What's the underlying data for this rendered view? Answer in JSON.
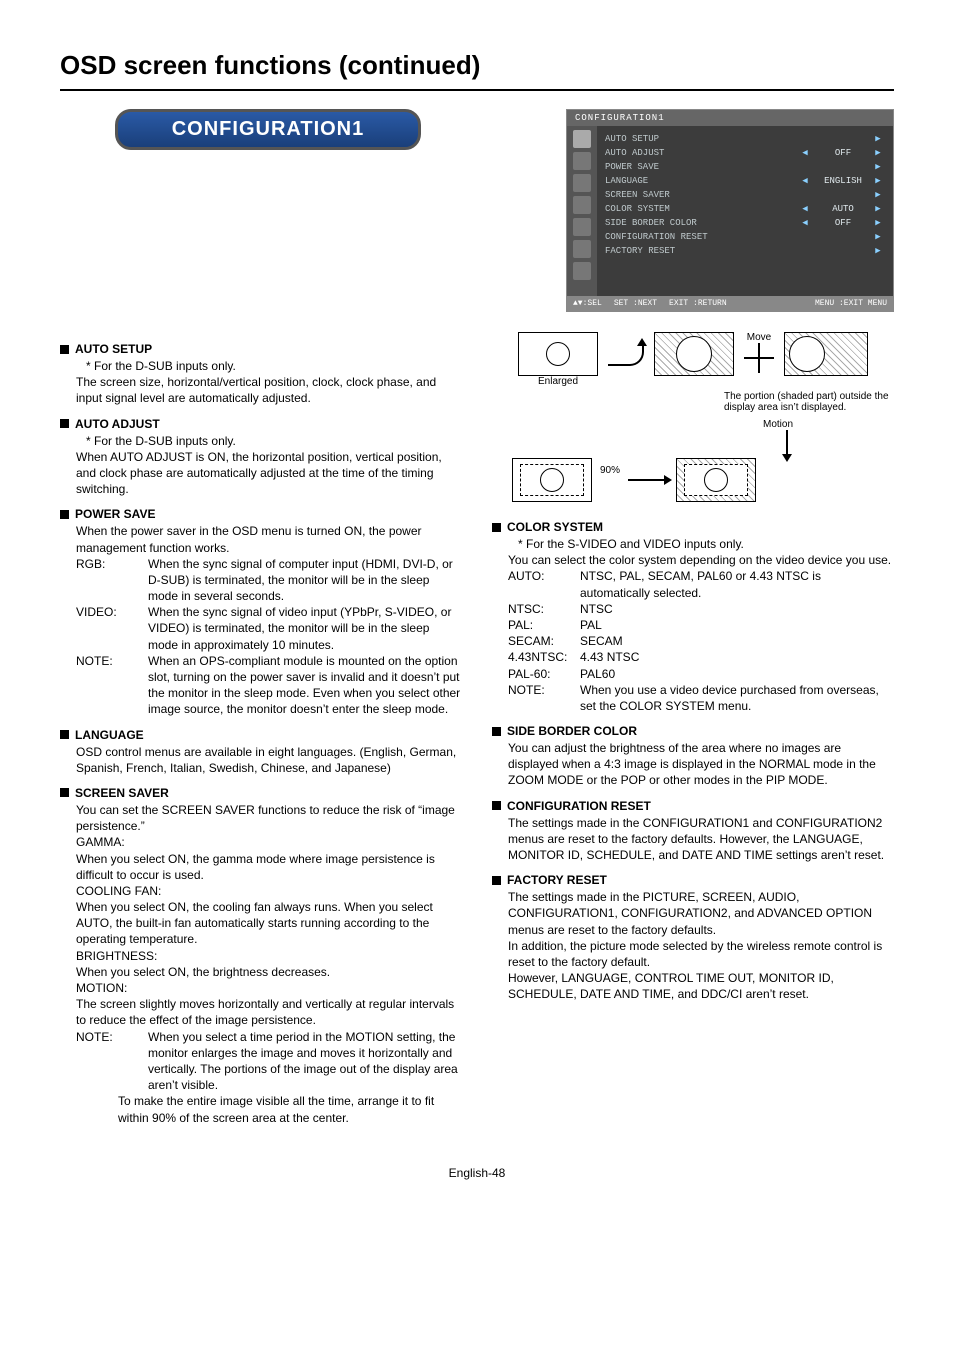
{
  "page_title": "OSD screen functions (continued)",
  "section_banner": "CONFIGURATION1",
  "osd": {
    "title": "CONFIGURATION1",
    "rows": [
      {
        "label": "AUTO SETUP",
        "left": false,
        "value": "",
        "right": true
      },
      {
        "label": "AUTO ADJUST",
        "left": true,
        "value": "OFF",
        "right": true
      },
      {
        "label": "POWER SAVE",
        "left": false,
        "value": "",
        "right": true
      },
      {
        "label": "LANGUAGE",
        "left": true,
        "value": "ENGLISH",
        "right": true
      },
      {
        "label": "SCREEN SAVER",
        "left": false,
        "value": "",
        "right": true
      },
      {
        "label": "COLOR SYSTEM",
        "left": true,
        "value": "AUTO",
        "right": true
      },
      {
        "label": "SIDE BORDER COLOR",
        "left": true,
        "value": "OFF",
        "right": true
      },
      {
        "label": "CONFIGURATION RESET",
        "left": false,
        "value": "",
        "right": true
      },
      {
        "label": "FACTORY RESET",
        "left": false,
        "value": "",
        "right": true
      }
    ],
    "footer": {
      "sel": "▲▼:SEL",
      "next": "SET :NEXT",
      "ret": "EXIT :RETURN",
      "exitmenu": "MENU :EXIT MENU"
    }
  },
  "diagram": {
    "enlarged": "Enlarged",
    "move": "Move",
    "portion_note": "The portion (shaded part) outside the display area isn’t displayed.",
    "motion": "Motion",
    "ninety": "90%"
  },
  "left": {
    "auto_setup": {
      "head": "AUTO SETUP",
      "star": "*",
      "star_text": "For the D-SUB inputs only.",
      "body": "The screen size, horizontal/vertical position, clock, clock phase, and input signal level are automatically adjusted."
    },
    "auto_adjust": {
      "head": "AUTO ADJUST",
      "star": "*",
      "star_text": "For the D-SUB inputs only.",
      "body": "When AUTO ADJUST is ON, the horizontal position, vertical position, and clock phase are automatically adjusted at the time of the timing switching."
    },
    "power_save": {
      "head": "POWER SAVE",
      "intro": "When the power saver in the OSD menu is turned ON, the power management function works.",
      "rgb_k": "RGB:",
      "rgb_v": "When the sync signal of computer input (HDMI, DVI-D, or D-SUB) is terminated, the monitor will be in the sleep mode in several seconds.",
      "video_k": "VIDEO:",
      "video_v": "When the sync signal of video input (YPbPr, S-VIDEO, or VIDEO) is terminated, the monitor will be in the sleep mode in approximately 10 minutes.",
      "note_k": "NOTE:",
      "note_v": "When an OPS-compliant module is mounted on the option slot, turning on the power saver is invalid and it doesn’t put the monitor in the sleep mode. Even when you select other image source, the monitor doesn’t enter the sleep mode."
    },
    "language": {
      "head": "LANGUAGE",
      "body": "OSD control menus are available in eight languages. (English, German, Spanish, French, Italian, Swedish, Chinese, and Japanese)"
    },
    "screen_saver": {
      "head": "SCREEN SAVER",
      "intro": "You can set the SCREEN SAVER functions to reduce the risk of “image persistence.”",
      "gamma_k": "GAMMA:",
      "gamma_v": "When you select ON, the gamma mode where image persistence is difficult to occur is used.",
      "fan_k": "COOLING FAN:",
      "fan_v": "When you select ON, the cooling fan always runs. When you select AUTO, the built-in fan automatically starts running according to the operating temperature.",
      "bright_k": "BRIGHTNESS:",
      "bright_v": "When you select ON, the brightness decreases.",
      "motion_k": "MOTION:",
      "motion_v": "The screen slightly moves horizontally and vertically at regular intervals to reduce the effect of the image persistence.",
      "note_k": "NOTE:",
      "note_v1": "When you select a time period in the MOTION setting, the monitor enlarges the image and moves it horizontally and vertically. The portions of the image out of the display area aren’t visible.",
      "note_v2": "To make the entire image visible all the time, arrange it to fit within 90% of the screen area at the center."
    }
  },
  "right": {
    "color_system": {
      "head": "COLOR SYSTEM",
      "star": "*",
      "star_text": "For the S-VIDEO and VIDEO inputs only.",
      "intro": "You can select the color system depending on the video device you use.",
      "rows": [
        {
          "k": "AUTO:",
          "v": "NTSC, PAL, SECAM, PAL60 or 4.43 NTSC is automatically selected."
        },
        {
          "k": "NTSC:",
          "v": "NTSC"
        },
        {
          "k": "PAL:",
          "v": "PAL"
        },
        {
          "k": "SECAM:",
          "v": "SECAM"
        },
        {
          "k": "4.43NTSC:",
          "v": "4.43 NTSC"
        },
        {
          "k": "PAL-60:",
          "v": "PAL60"
        }
      ],
      "note_k": "NOTE:",
      "note_v": "When you use a video device purchased from overseas, set the COLOR SYSTEM menu."
    },
    "side_border": {
      "head": "SIDE BORDER COLOR",
      "body": "You can adjust the brightness of the area where no images are displayed when a 4:3 image is displayed in the NORMAL mode in the ZOOM MODE or the POP or other modes in the PIP MODE."
    },
    "config_reset": {
      "head": "CONFIGURATION RESET",
      "body": "The settings made in the CONFIGURATION1 and CONFIGURATION2 menus are reset to the factory defaults. However, the LANGUAGE, MONITOR ID, SCHEDULE, and DATE AND TIME settings aren’t reset."
    },
    "factory_reset": {
      "head": "FACTORY RESET",
      "body1": "The settings made in the PICTURE, SCREEN, AUDIO, CONFIGURATION1, CONFIGURATION2, and ADVANCED OPTION menus are reset to the factory defaults.",
      "body2": "In addition, the picture mode selected by the wireless remote control is reset to the factory default.",
      "body3": "However, LANGUAGE, CONTROL TIME OUT, MONITOR ID, SCHEDULE, DATE AND TIME, and DDC/CI aren’t reset."
    }
  },
  "page_number": "English-48"
}
